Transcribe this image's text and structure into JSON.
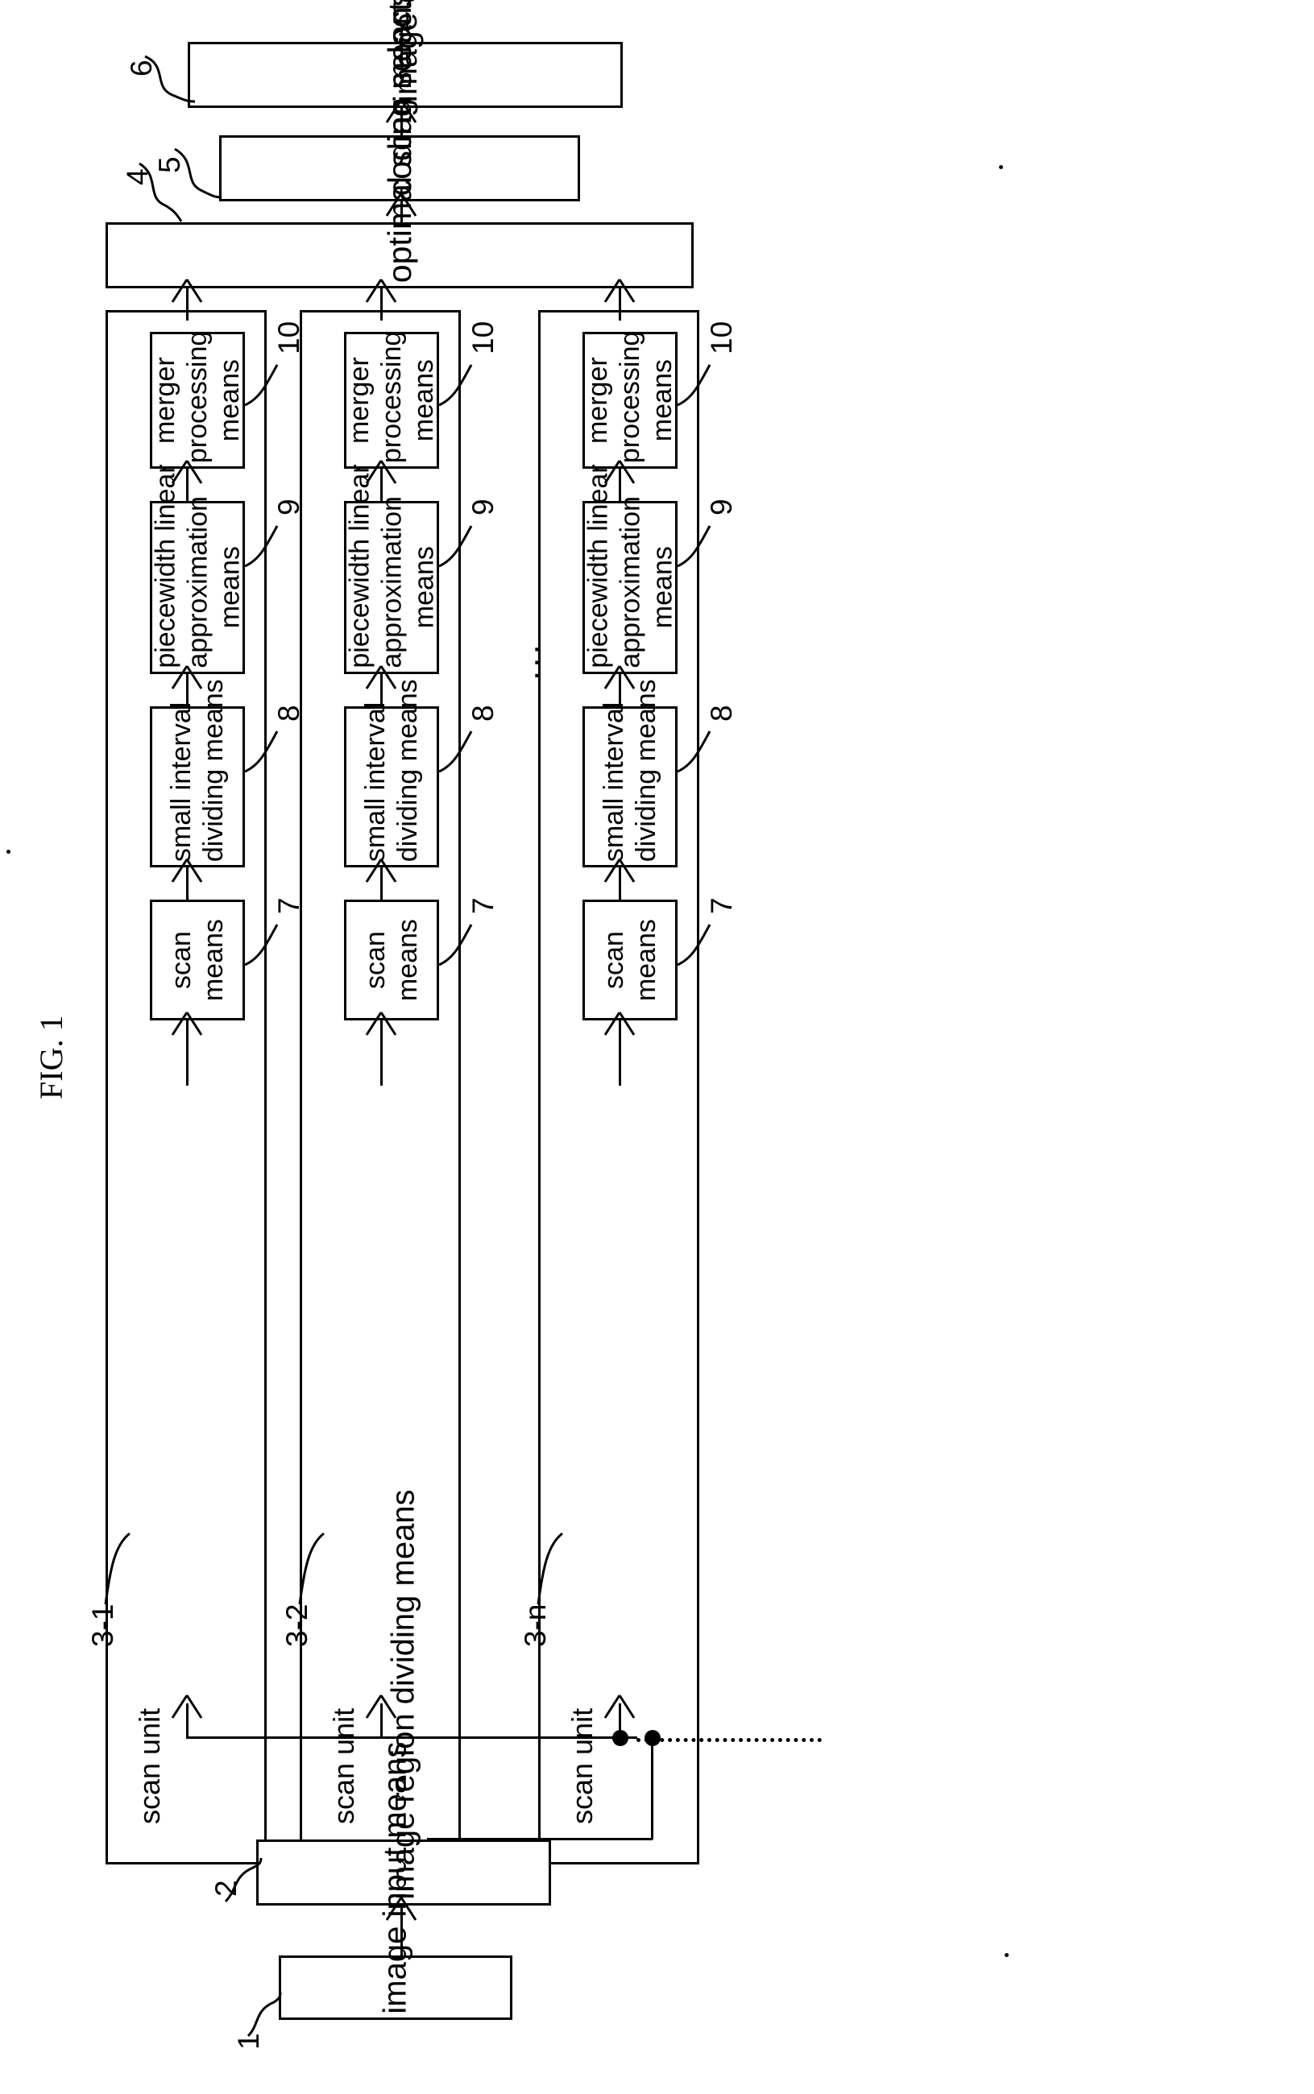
{
  "figure": {
    "label": "FIG. 1",
    "type": "patent-block-diagram",
    "orientation": "rotated-90-ccw"
  },
  "blocks": {
    "image_input": {
      "ref": "1",
      "label": "image input means"
    },
    "region_dividing": {
      "ref": "2",
      "label": "image region dividing means"
    },
    "optimal_scan": {
      "ref": "4",
      "label": "optimal scan selecting means"
    },
    "coding": {
      "ref": "5",
      "label": "coding means"
    },
    "output": {
      "ref": "6",
      "label": "image compression data output means"
    }
  },
  "scan_units": [
    {
      "ref": "3-1",
      "title": "scan unit",
      "stages": [
        {
          "ref": "7",
          "label": "scan\nmeans"
        },
        {
          "ref": "8",
          "label": "small interval\ndividing means"
        },
        {
          "ref": "9",
          "label": "piecewidth linear\napproximation\nmeans"
        },
        {
          "ref": "10",
          "label": "merger\nprocessing\nmeans"
        }
      ]
    },
    {
      "ref": "3-2",
      "title": "scan unit",
      "stages": [
        {
          "ref": "7",
          "label": "scan\nmeans"
        },
        {
          "ref": "8",
          "label": "small interval\ndividing means"
        },
        {
          "ref": "9",
          "label": "piecewidth linear\napproximation\nmeans"
        },
        {
          "ref": "10",
          "label": "merger\nprocessing\nmeans"
        }
      ]
    },
    {
      "ref": "3-n",
      "title": "scan unit",
      "stages": [
        {
          "ref": "7",
          "label": "scan\nmeans"
        },
        {
          "ref": "8",
          "label": "small interval\ndividing means"
        },
        {
          "ref": "9",
          "label": "piecewidth linear\napproximation\nmeans"
        },
        {
          "ref": "10",
          "label": "merger\nprocessing\nmeans"
        }
      ]
    }
  ],
  "ellipsis": "...",
  "colors": {
    "ink": "#000000",
    "paper": "#ffffff"
  }
}
